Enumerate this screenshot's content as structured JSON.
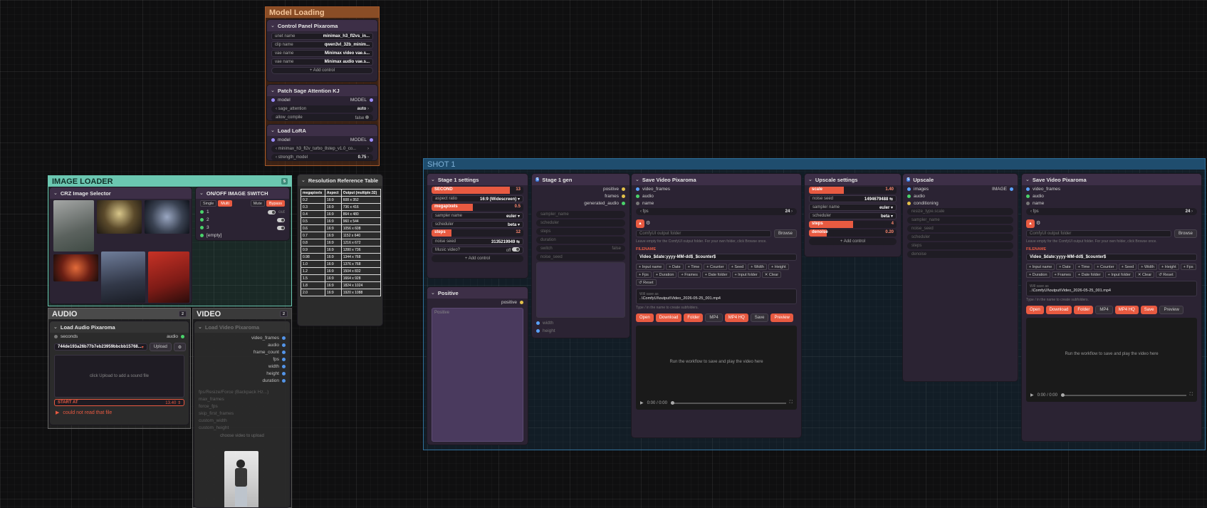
{
  "groups": {
    "model_loading": {
      "title": "Model Loading"
    },
    "image_loader": {
      "title": "IMAGE LOADER",
      "badge": "5"
    },
    "audio": {
      "title": "AUDIO",
      "badge": "2"
    },
    "video": {
      "title": "VIDEO",
      "badge": "2"
    },
    "shot1": {
      "title": "SHOT 1"
    }
  },
  "control_panel": {
    "title": "Control Panel Pixaroma",
    "rows": [
      {
        "label": "unet name",
        "value": "minimax_h3_fl2vs_in..."
      },
      {
        "label": "clip name",
        "value": "qwen3vl_32b_minim..."
      },
      {
        "label": "vae name",
        "value": "Minimax video vae.s..."
      },
      {
        "label": "vae name",
        "value": "Minimax audio vae.s..."
      }
    ],
    "add": "+ Add control"
  },
  "sage": {
    "title": "Patch Sage Attention KJ",
    "in": "model",
    "out": "MODEL",
    "w1_label": "sage_attention",
    "w1_value": "auto",
    "w2_label": "allow_compile",
    "w2_value": "false"
  },
  "lora": {
    "title": "Load LoRA",
    "in": "model",
    "out": "MODEL",
    "w1_value": "minimax_h3_fl2v_turbo_8step_v1.0_co...",
    "w2_label": "strength_model",
    "w2_value": "0.75"
  },
  "res_table": {
    "title": "Resolution Reference Table",
    "headers": [
      "megapixels",
      "Aspect",
      "Output (multiple:32)"
    ],
    "rows": [
      [
        "0.2",
        "16:9",
        "608 x 352"
      ],
      [
        "0.3",
        "16:9",
        "736 x 416"
      ],
      [
        "0.4",
        "16:9",
        "864 x 480"
      ],
      [
        "0.5",
        "16:9",
        "960 x 544"
      ],
      [
        "0.6",
        "16:9",
        "1056 x 608"
      ],
      [
        "0.7",
        "16:9",
        "1152 x 640"
      ],
      [
        "0.8",
        "16:9",
        "1216 x 672"
      ],
      [
        "0.9",
        "16:9",
        "1280 x 736"
      ],
      [
        "0.98",
        "16:9",
        "1344 x 768"
      ],
      [
        "1.0",
        "16:9",
        "1376 x 768"
      ],
      [
        "1.2",
        "16:9",
        "1504 x 832"
      ],
      [
        "1.5",
        "16:9",
        "1664 x 928"
      ],
      [
        "1.8",
        "16:9",
        "1824 x 1024"
      ],
      [
        "2.0",
        "16:9",
        "1920 x 1088"
      ]
    ]
  },
  "image_selector": {
    "title": "CRZ Image Selector",
    "count_in": "25"
  },
  "onoff": {
    "title": "ON/OFF IMAGE SWITCH",
    "tab_single": "Single",
    "tab_multi": "Multi",
    "mute": "Mute",
    "bypass": "Bypass",
    "items": [
      "1",
      "2",
      "3",
      "[empty]"
    ],
    "out": "out"
  },
  "load_audio": {
    "title": "Load Audio Pixaroma",
    "in": "seconds",
    "out": "audio",
    "file": "744de193a26b77b7eb23959bbcbb15768...",
    "upload": "Upload",
    "drop": "click Upload to add a sound file",
    "start_label": "START AT",
    "start_value": "13.40",
    "error": "could not read that file"
  },
  "load_video": {
    "title": "Load Video Pixaroma",
    "outputs": [
      "video_frames",
      "audio",
      "frame_count",
      "fps",
      "width",
      "height",
      "duration"
    ],
    "disabled": [
      "fps/Resize/Force (Backpack Hz...)",
      "max_frames",
      "force_fps",
      "skip_first_frames",
      "custom_width",
      "custom_height"
    ],
    "choose": "choose video to upload"
  },
  "stage1_settings": {
    "title": "Stage 1 settings",
    "second_label": "SECOND",
    "second_value": "13",
    "aspect_label": "aspect ratio",
    "aspect_value": "16:9 (Widescreen)",
    "mp_label": "megapixels",
    "mp_value": "0.5",
    "sampler_label": "sampler name",
    "sampler_value": "euler",
    "scheduler_label": "scheduler",
    "scheduler_value": "beta",
    "steps_label": "steps",
    "steps_value": "12",
    "seed_label": "noise seed",
    "seed_value": "3135219949",
    "music_label": "Music video?",
    "music_value": "off",
    "add": "+ Add control"
  },
  "positive": {
    "title": "Positive",
    "out": "positive",
    "placeholder": "Positive"
  },
  "stage1_gen": {
    "title": "Stage 1 gen",
    "outputs": [
      "positive",
      "frames",
      "generated_audio"
    ],
    "inputs": [
      "sampler_name",
      "scheduler",
      "steps",
      "duration",
      "switch",
      "noise_seed"
    ],
    "switch_val": "false",
    "bottom": [
      "width",
      "height"
    ]
  },
  "save_video": {
    "title": "Save Video Pixaroma",
    "inputs": [
      "video_frames",
      "audio",
      "name"
    ],
    "fps_label": "fps",
    "fps_value": "24",
    "folder_placeholder": "ComfyUI output folder",
    "browse": "Browse",
    "folder_hint": "Leave empty for the ComfyUI output folder. For your own folder, click Browse once.",
    "filename_label": "FILENAME",
    "filename": "Video_$date:yyyy-MM-dd$_$counter$",
    "chips": [
      "+ Input name",
      "+ Date",
      "+ Time",
      "+ Counter",
      "+ Seed",
      "+ Width",
      "+ Height",
      "+ Fps",
      "+ Duration",
      "+ Frames",
      "+ Date folder",
      "+ Input folder",
      "✕ Clear",
      "↺ Reset"
    ],
    "saved_label": "Will save as",
    "saved_path": "..\\ComfyUI\\output\\Video_2026-05-25_001.mp4",
    "type_hint": "Type / in the name to create subfolders.",
    "open": "Open",
    "download": "Download",
    "folder": "Folder",
    "mp4": "MP4",
    "mp4hq": "MP4 HQ",
    "save": "Save",
    "preview": "Preview",
    "player_msg": "Run the workflow to save and play the video here",
    "time": "0:00 / 0:00"
  },
  "upscale_settings": {
    "title": "Upscale settings",
    "scale_label": "scale",
    "scale_value": "1.40",
    "seed_label": "noise seed",
    "seed_value": "1494679488",
    "sampler_label": "sampler name",
    "sampler_value": "euler",
    "scheduler_label": "scheduler",
    "scheduler_value": "beta",
    "steps_label": "steps",
    "steps_value": "4",
    "denoise_label": "denoise",
    "denoise_value": "0.20",
    "add": "+ Add control"
  },
  "upscale": {
    "title": "Upscale",
    "inputs": [
      "images",
      "audio",
      "conditioning"
    ],
    "out": "IMAGE",
    "disabled": [
      "resize_type.scale",
      "sampler_name",
      "noise_seed",
      "scheduler",
      "steps",
      "denoise"
    ]
  },
  "colors": {
    "accent": "#e85a41",
    "node": "#2b2333",
    "group_teal": "#6bc7b1",
    "group_blue": "#2f6f9a",
    "group_orange": "#c8642a"
  }
}
